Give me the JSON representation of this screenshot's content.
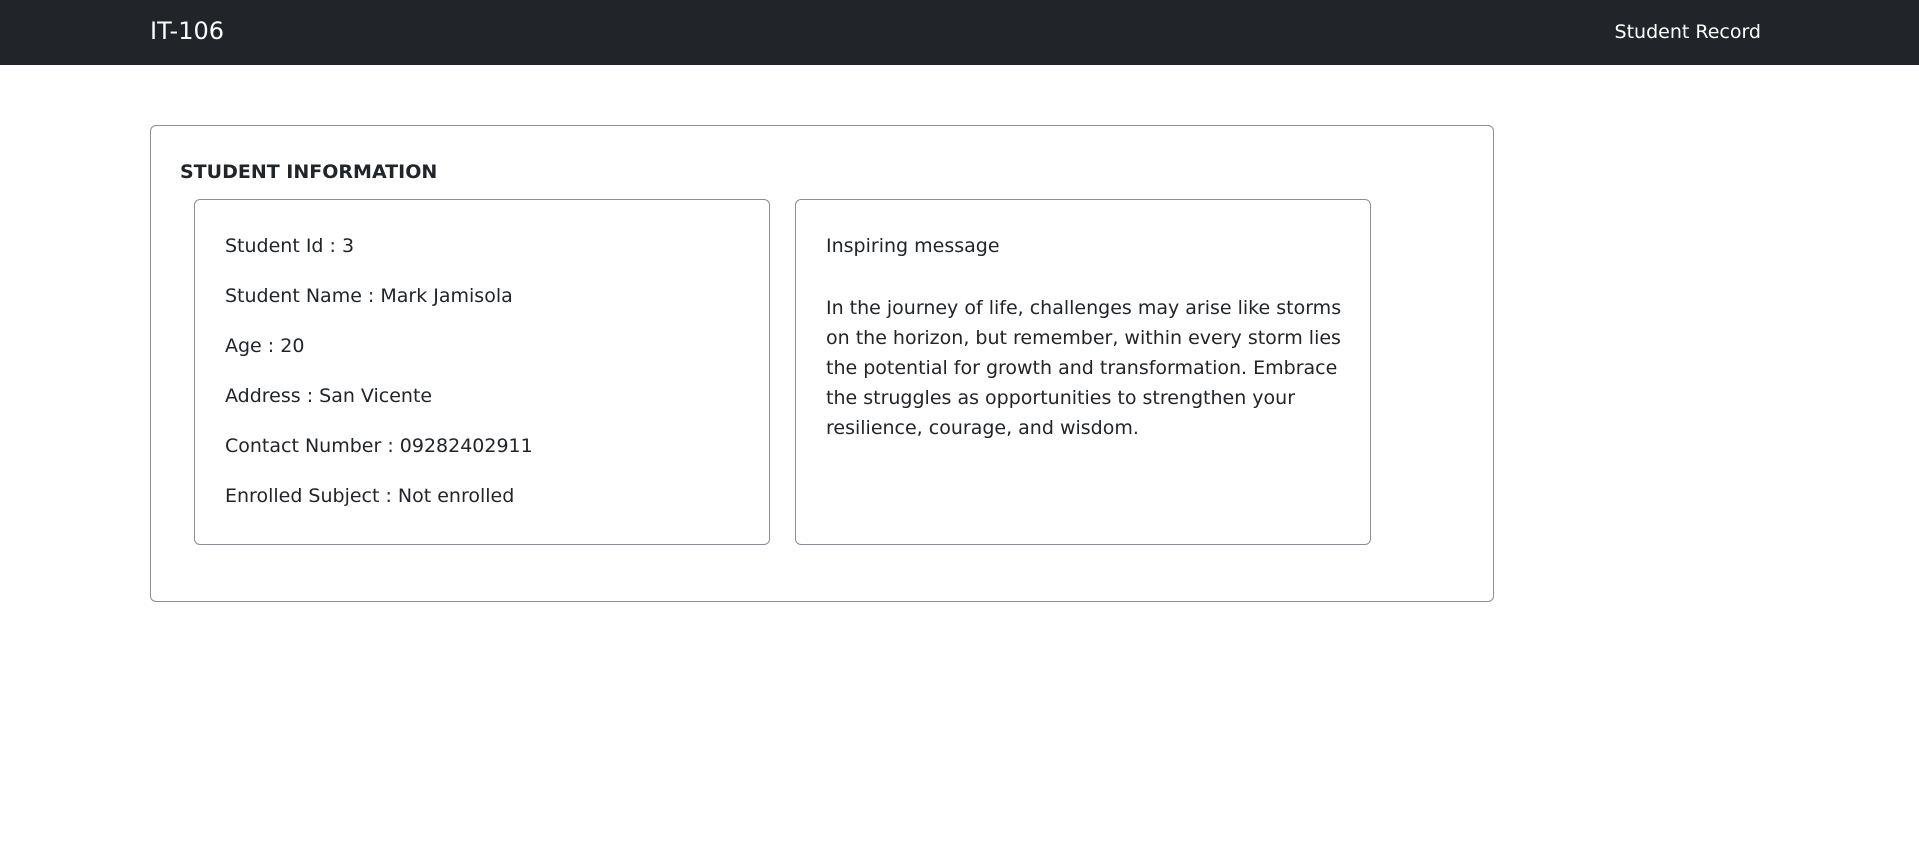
{
  "navbar": {
    "brand": "IT-106",
    "link": "Student Record"
  },
  "main": {
    "section_title": "STUDENT INFORMATION",
    "student": {
      "id": "Student Id : 3",
      "name": "Student Name : Mark Jamisola",
      "age": "Age : 20",
      "address": "Address : San Vicente",
      "contact": "Contact Number : 09282402911",
      "subject": "Enrolled Subject : Not enrolled"
    },
    "message": {
      "title": "Inspiring message",
      "body": "In the journey of life, challenges may arise like storms on the horizon, but remember, within every storm lies the potential for growth and transformation. Embrace the struggles as opportunities to strengthen your resilience, courage, and wisdom."
    }
  },
  "colors": {
    "navbar_bg": "#212529",
    "text": "#212529",
    "border": "#8a8f94"
  }
}
